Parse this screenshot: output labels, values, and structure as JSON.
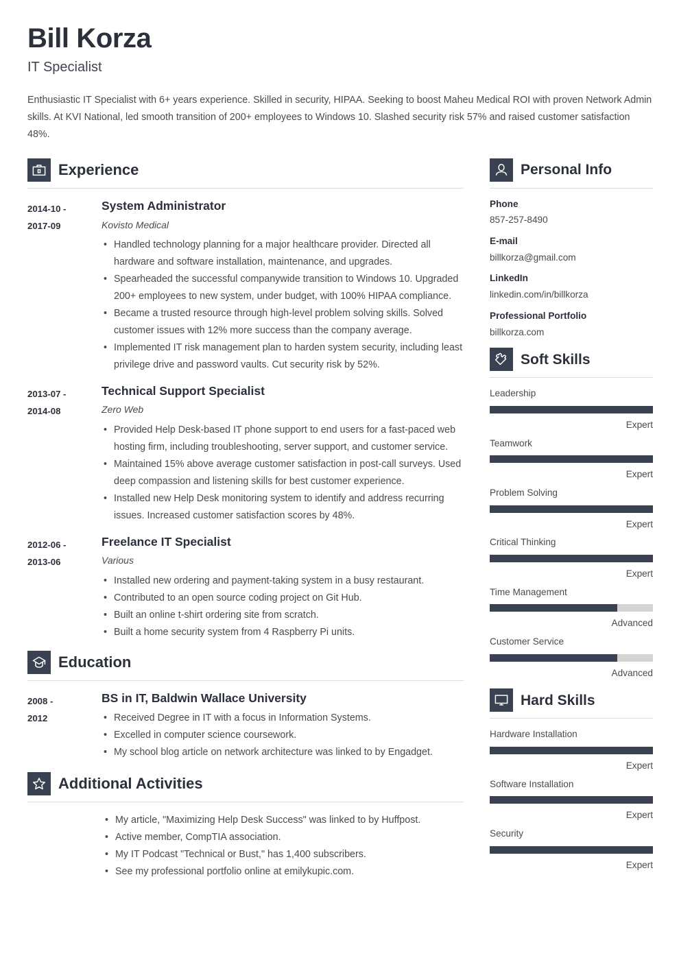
{
  "theme": {
    "accent": "#3a4151",
    "heading": "#2b303b",
    "body_text": "#4a4a4a",
    "track": "#d4d4d4"
  },
  "header": {
    "full_name": "Bill Korza",
    "job_title": "IT Specialist",
    "summary": "Enthusiastic IT Specialist with 6+ years experience. Skilled in security, HIPAA. Seeking to boost Maheu Medical ROI with proven Network Admin skills. At KVI National, led smooth transition of 200+ employees to Windows 10. Slashed security risk 57% and raised customer satisfaction 48%."
  },
  "experience": {
    "title": "Experience",
    "icon": "briefcase-icon",
    "entries": [
      {
        "dates": "2014-10 - 2017-09",
        "date_start": "2014-10 -",
        "date_end": "2017-09",
        "role": "System Administrator",
        "organization": "Kovisto Medical",
        "bullets": [
          "Handled technology planning for a major healthcare provider. Directed all hardware and software installation, maintenance, and upgrades.",
          "Spearheaded the successful companywide transition to Windows 10. Upgraded 200+ employees to new system, under budget, with 100% HIPAA compliance.",
          "Became a trusted resource through high-level problem solving skills. Solved customer issues with 12% more success than the company average.",
          "Implemented IT risk management plan to harden system security, including least privilege drive and password vaults. Cut security risk by 52%."
        ]
      },
      {
        "dates": "2013-07 - 2014-08",
        "date_start": "2013-07 -",
        "date_end": "2014-08",
        "role": "Technical Support Specialist",
        "organization": "Zero Web",
        "bullets": [
          "Provided Help Desk-based IT phone support to end users for a fast-paced web hosting firm, including troubleshooting, server support, and customer service.",
          "Maintained 15% above average customer satisfaction in post-call surveys. Used deep compassion and listening skills for best customer experience.",
          "Installed new Help Desk monitoring system to identify and address recurring issues. Increased customer satisfaction scores by 48%."
        ]
      },
      {
        "dates": "2012-06 - 2013-06",
        "date_start": "2012-06 -",
        "date_end": "2013-06",
        "role": "Freelance IT Specialist",
        "organization": "Various",
        "bullets": [
          "Installed new ordering and payment-taking system in a busy restaurant.",
          "Contributed to an open source coding project on Git Hub.",
          "Built an online t-shirt ordering site from scratch.",
          "Built a home security system from 4 Raspberry Pi units."
        ]
      }
    ]
  },
  "education": {
    "title": "Education",
    "icon": "graduation-cap-icon",
    "entries": [
      {
        "date_start": "2008 -",
        "date_end": "2012",
        "role": "BS in IT, Baldwin Wallace University",
        "bullets": [
          "Received Degree in IT with a focus in Information Systems.",
          "Excelled in computer science coursework.",
          "My school blog article on network architecture was linked to by Engadget."
        ]
      }
    ]
  },
  "activities": {
    "title": "Additional Activities",
    "icon": "star-icon",
    "bullets": [
      "My article, \"Maximizing Help Desk Success\" was linked to by Huffpost.",
      "Active member, CompTIA association.",
      "My IT Podcast \"Technical or Bust,\" has 1,400 subscribers.",
      "See my professional portfolio online at emilykupic.com."
    ]
  },
  "personal_info": {
    "title": "Personal Info",
    "icon": "person-icon",
    "items": [
      {
        "label": "Phone",
        "value": "857-257-8490"
      },
      {
        "label": "E-mail",
        "value": "billkorza@gmail.com"
      },
      {
        "label": "LinkedIn",
        "value": "linkedin.com/in/billkorza"
      },
      {
        "label": "Professional Portfolio",
        "value": "billkorza.com"
      }
    ]
  },
  "soft_skills": {
    "title": "Soft Skills",
    "icon": "puzzle-piece-icon",
    "items": [
      {
        "name": "Leadership",
        "level": "Expert",
        "percent": 100
      },
      {
        "name": "Teamwork",
        "level": "Expert",
        "percent": 100
      },
      {
        "name": "Problem Solving",
        "level": "Expert",
        "percent": 100
      },
      {
        "name": "Critical Thinking",
        "level": "Expert",
        "percent": 100
      },
      {
        "name": "Time Management",
        "level": "Advanced",
        "percent": 78
      },
      {
        "name": "Customer Service",
        "level": "Advanced",
        "percent": 78
      }
    ]
  },
  "hard_skills": {
    "title": "Hard Skills",
    "icon": "monitor-icon",
    "items": [
      {
        "name": "Hardware Installation",
        "level": "Expert",
        "percent": 100
      },
      {
        "name": "Software Installation",
        "level": "Expert",
        "percent": 100
      },
      {
        "name": "Security",
        "level": "Expert",
        "percent": 100
      }
    ]
  }
}
